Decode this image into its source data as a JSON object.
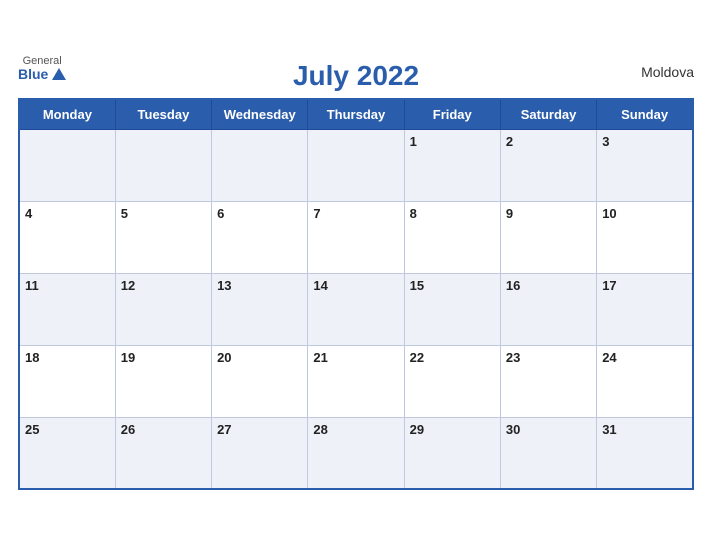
{
  "header": {
    "logo_general": "General",
    "logo_blue": "Blue",
    "title": "July 2022",
    "country": "Moldova"
  },
  "weekdays": [
    "Monday",
    "Tuesday",
    "Wednesday",
    "Thursday",
    "Friday",
    "Saturday",
    "Sunday"
  ],
  "weeks": [
    [
      null,
      null,
      null,
      null,
      1,
      2,
      3
    ],
    [
      4,
      5,
      6,
      7,
      8,
      9,
      10
    ],
    [
      11,
      12,
      13,
      14,
      15,
      16,
      17
    ],
    [
      18,
      19,
      20,
      21,
      22,
      23,
      24
    ],
    [
      25,
      26,
      27,
      28,
      29,
      30,
      31
    ]
  ],
  "colors": {
    "header_bg": "#2a5dab",
    "odd_row_bg": "#eef1f8",
    "even_row_bg": "#ffffff",
    "title_color": "#2a5dab"
  }
}
